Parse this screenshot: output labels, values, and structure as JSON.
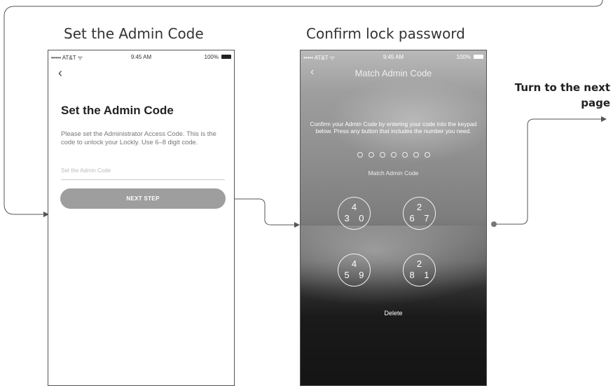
{
  "labels": {
    "left_title": "Set the Admin Code",
    "right_title": "Confirm lock password",
    "note": "Turn to the next page"
  },
  "colors": {
    "flow_line": "#555555",
    "button_gray": "#9e9e9e"
  },
  "phone1": {
    "status": {
      "carrier": "••••• AT&T ᯤ",
      "time": "9:45 AM",
      "battery": "100%"
    },
    "back_icon": "chevron-left-icon",
    "heading": "Set the Admin Code",
    "description": "Please set the Administrator Access Code. This is the code to unlock your Lockly. Use 6–8 digit code.",
    "input_placeholder": "Set the Admin Code",
    "button": "NEXT STEP"
  },
  "phone2": {
    "status": {
      "carrier": "••••• AT&T ᯤ",
      "time": "9:45 AM",
      "battery": "100%"
    },
    "back_icon": "chevron-left-icon",
    "title": "Match Admin Code",
    "description": "Confirm your Admin Code by entering your code into the keypad below. Press any button that includes the number you need.",
    "code_dots": 7,
    "subtitle": "Match Admin Code",
    "keys": [
      {
        "top": "4",
        "bottom": "3 0"
      },
      {
        "top": "2",
        "bottom": "6 7"
      },
      {
        "top": "4",
        "bottom": "5 9"
      },
      {
        "top": "2",
        "bottom": "8 1"
      }
    ],
    "delete": "Delete"
  }
}
